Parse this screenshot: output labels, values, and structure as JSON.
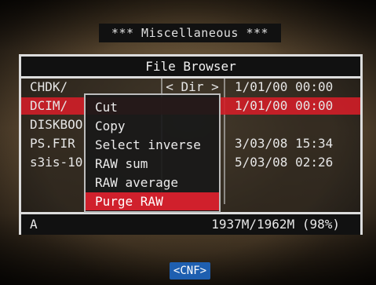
{
  "screen_title": "*** Miscellaneous ***",
  "panel": {
    "title": "File Browser",
    "files": [
      {
        "name": "CHDK/",
        "size": "< Dir >",
        "date": "1/01/00 00:00",
        "selected": false
      },
      {
        "name": "DCIM/",
        "size": "",
        "date": "1/01/00 00:00",
        "selected": true
      },
      {
        "name": "DISKBOO",
        "size": "",
        "date": "",
        "selected": false
      },
      {
        "name": "PS.FIR",
        "size": "",
        "date": "3/03/08 15:34",
        "selected": false
      },
      {
        "name": "s3is-10",
        "size": "",
        "date": "5/03/08 02:26",
        "selected": false
      }
    ],
    "footer": {
      "drive": "A",
      "space": "1937M/1962M (98%)"
    }
  },
  "context_menu": {
    "items": [
      {
        "label": "Cut",
        "active": false
      },
      {
        "label": "Copy",
        "active": false
      },
      {
        "label": "Select inverse",
        "active": false
      },
      {
        "label": "RAW sum",
        "active": false
      },
      {
        "label": "RAW average",
        "active": false
      },
      {
        "label": "Purge RAW",
        "active": true
      }
    ]
  },
  "cnf_button": {
    "label": "<CNF>"
  },
  "colors": {
    "highlight": "#d0202c",
    "button": "#1e5fb0"
  }
}
